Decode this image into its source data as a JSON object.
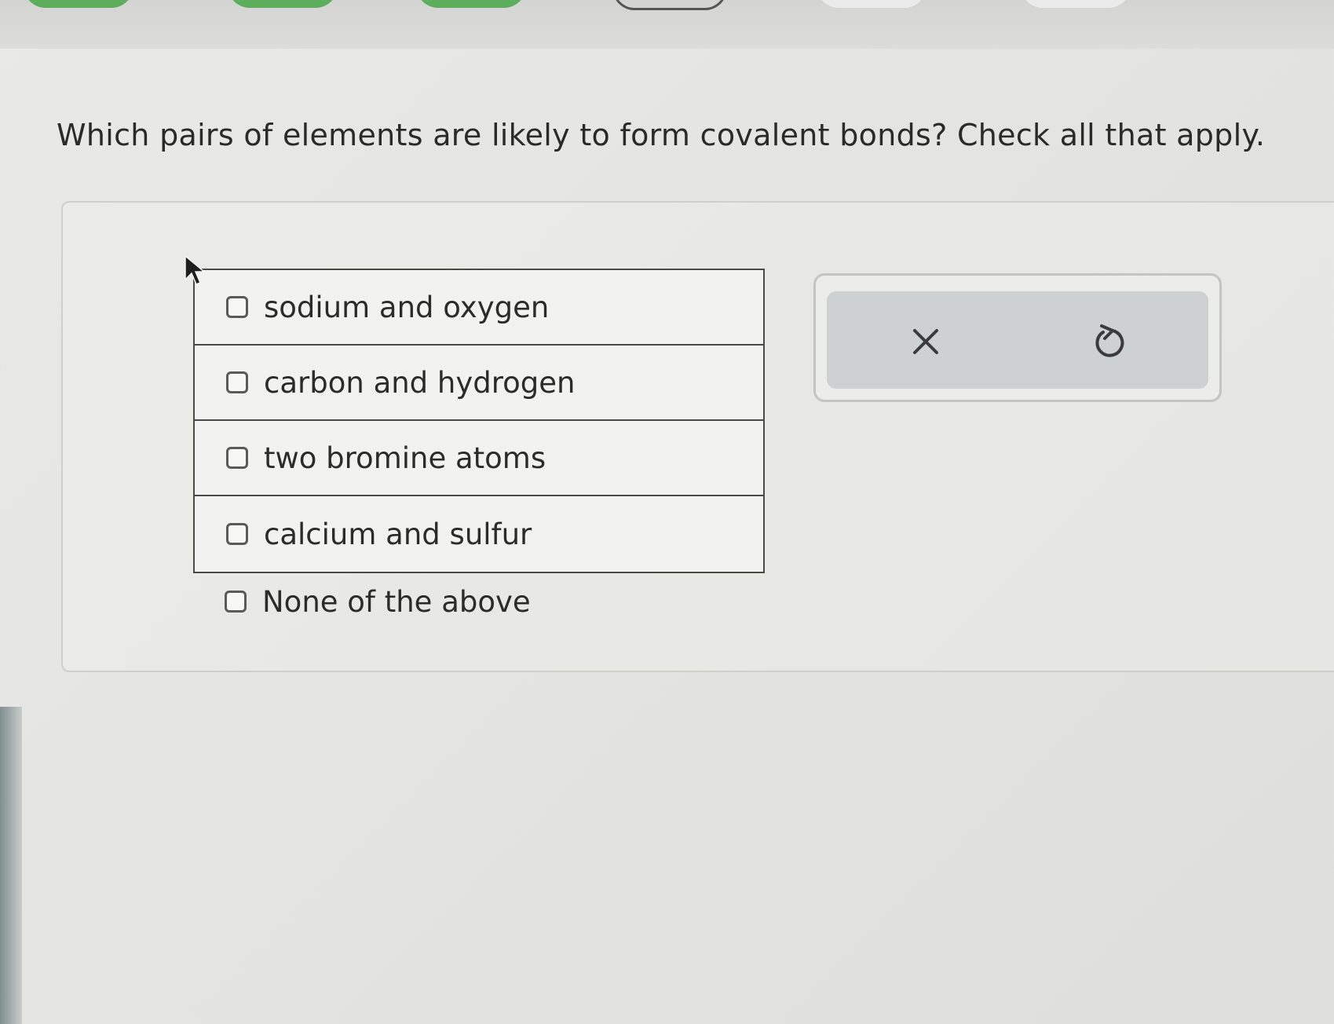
{
  "question": {
    "text": "Which pairs of elements are likely to form covalent bonds? Check all that apply."
  },
  "options": [
    {
      "label": "sodium and oxygen",
      "checked": false
    },
    {
      "label": "carbon and hydrogen",
      "checked": false
    },
    {
      "label": "two bromine atoms",
      "checked": false
    },
    {
      "label": "calcium and sulfur",
      "checked": false
    }
  ],
  "none_option": {
    "label": "None of the above",
    "checked": false
  },
  "toolbar": {
    "clear_icon": "close-icon",
    "undo_icon": "undo-icon"
  },
  "colors": {
    "background": "#e5e5e3",
    "table_border": "#4a4a4a",
    "toolbar_fill": "#cdd1d1",
    "tab_green": "#5cae5c"
  }
}
